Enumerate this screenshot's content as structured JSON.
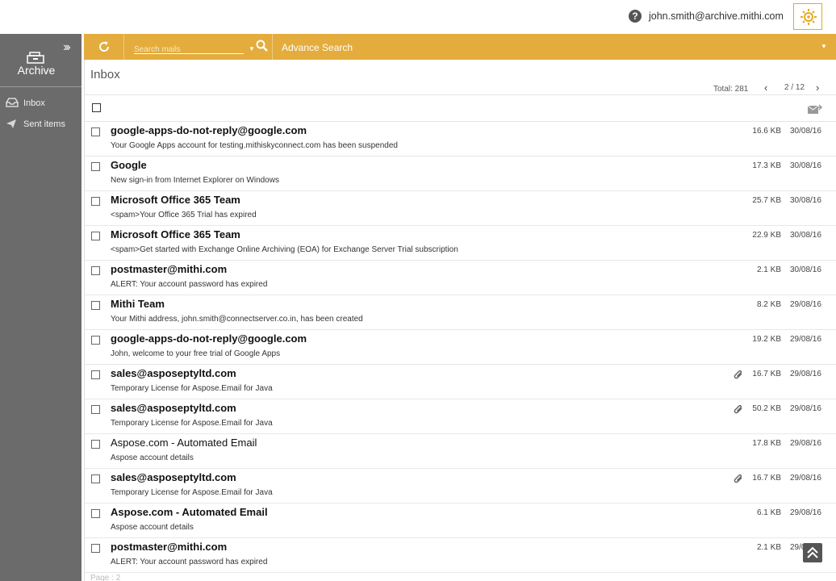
{
  "header": {
    "user_email": "john.smith@archive.mithi.com",
    "help_icon": "question-circle-icon",
    "settings_icon": "gear-sun-icon"
  },
  "sidebar": {
    "app_label": "Archive",
    "items": [
      {
        "label": "Inbox",
        "icon": "inbox-tray-icon"
      },
      {
        "label": "Sent items",
        "icon": "paper-plane-icon"
      }
    ]
  },
  "toolbar": {
    "search_placeholder": "Search mails",
    "advance_search_label": "Advance Search",
    "accent_color": "#e3ac3d"
  },
  "list": {
    "folder_title": "Inbox",
    "total_label": "Total: 281",
    "page_indicator": "2 / 12",
    "footer_label": "Page : 2"
  },
  "mails": [
    {
      "sender": "google-apps-do-not-reply@google.com",
      "subject": "Your Google Apps account for testing.mithiskyconnect.com has been suspended",
      "size": "16.6 KB",
      "date": "30/08/16",
      "unread": true,
      "attachment": false
    },
    {
      "sender": "Google",
      "subject": "New sign-in from Internet Explorer on Windows",
      "size": "17.3 KB",
      "date": "30/08/16",
      "unread": true,
      "attachment": false
    },
    {
      "sender": "Microsoft Office 365 Team",
      "subject": "<spam>Your Office 365 Trial has expired",
      "size": "25.7 KB",
      "date": "30/08/16",
      "unread": true,
      "attachment": false
    },
    {
      "sender": "Microsoft Office 365 Team",
      "subject": "<spam>Get started with Exchange Online Archiving (EOA) for Exchange Server Trial subscription",
      "size": "22.9 KB",
      "date": "30/08/16",
      "unread": true,
      "attachment": false
    },
    {
      "sender": "postmaster@mithi.com",
      "subject": "ALERT: Your account password has expired",
      "size": "2.1 KB",
      "date": "30/08/16",
      "unread": true,
      "attachment": false
    },
    {
      "sender": "Mithi Team",
      "subject": "Your Mithi address, john.smith@connectserver.co.in, has been created",
      "size": "8.2 KB",
      "date": "29/08/16",
      "unread": true,
      "attachment": false
    },
    {
      "sender": "google-apps-do-not-reply@google.com",
      "subject": "John, welcome to your free trial of Google Apps",
      "size": "19.2 KB",
      "date": "29/08/16",
      "unread": true,
      "attachment": false
    },
    {
      "sender": "sales@asposeptyltd.com",
      "subject": "Temporary License for Aspose.Email for Java",
      "size": "16.7 KB",
      "date": "29/08/16",
      "unread": true,
      "attachment": true
    },
    {
      "sender": "sales@asposeptyltd.com",
      "subject": "Temporary License for Aspose.Email for Java",
      "size": "50.2 KB",
      "date": "29/08/16",
      "unread": true,
      "attachment": true
    },
    {
      "sender": "Aspose.com - Automated Email",
      "subject": "Aspose account details",
      "size": "17.8 KB",
      "date": "29/08/16",
      "unread": false,
      "attachment": false
    },
    {
      "sender": "sales@asposeptyltd.com",
      "subject": "Temporary License for Aspose.Email for Java",
      "size": "16.7 KB",
      "date": "29/08/16",
      "unread": true,
      "attachment": true
    },
    {
      "sender": "Aspose.com - Automated Email",
      "subject": "Aspose account details",
      "size": "6.1 KB",
      "date": "29/08/16",
      "unread": true,
      "attachment": false
    },
    {
      "sender": "postmaster@mithi.com",
      "subject": "ALERT: Your account password has expired",
      "size": "2.1 KB",
      "date": "29/08/16",
      "unread": true,
      "attachment": false
    }
  ]
}
